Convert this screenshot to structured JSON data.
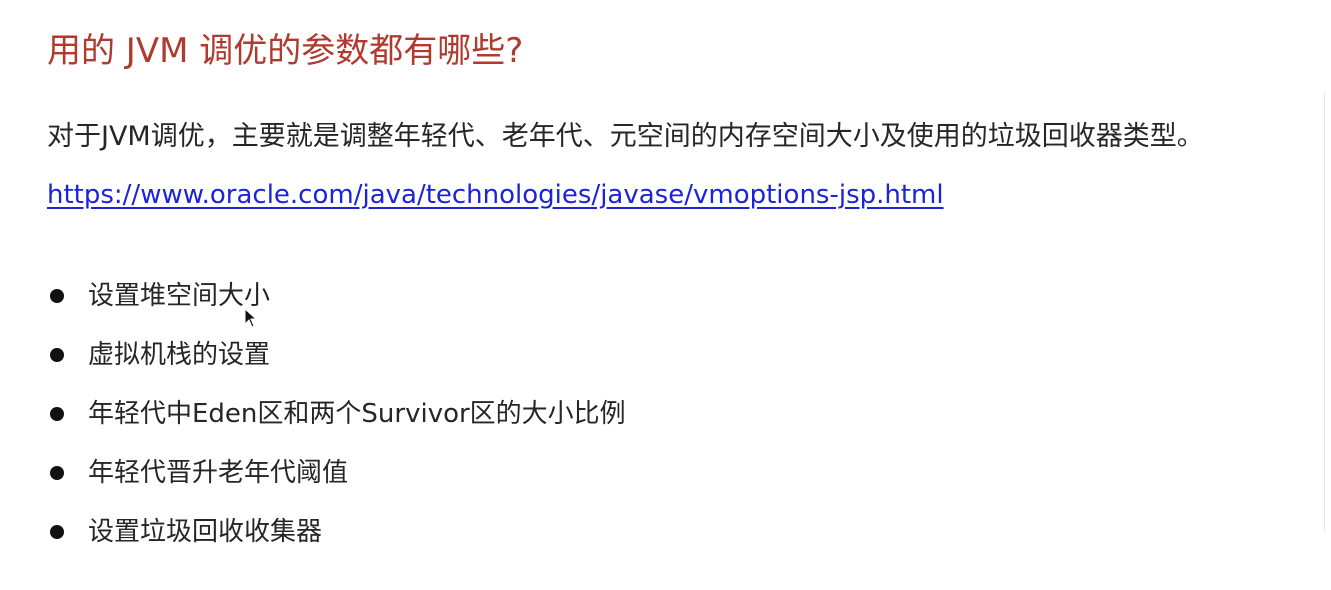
{
  "slide": {
    "title": "用的 JVM 调优的参数都有哪些?",
    "intro": "对于JVM调优，主要就是调整年轻代、老年代、元空间的内存空间大小及使用的垃圾回收器类型。",
    "link": "https://www.oracle.com/java/technologies/javase/vmoptions-jsp.html",
    "bullets": [
      "设置堆空间大小",
      "虚拟机栈的设置",
      "年轻代中Eden区和两个Survivor区的大小比例",
      "年轻代晋升老年代阈值",
      "设置垃圾回收收集器"
    ]
  },
  "colors": {
    "title": "#b03a2e",
    "link": "#1b24d6",
    "text": "#262626",
    "bullet": "#111111"
  }
}
